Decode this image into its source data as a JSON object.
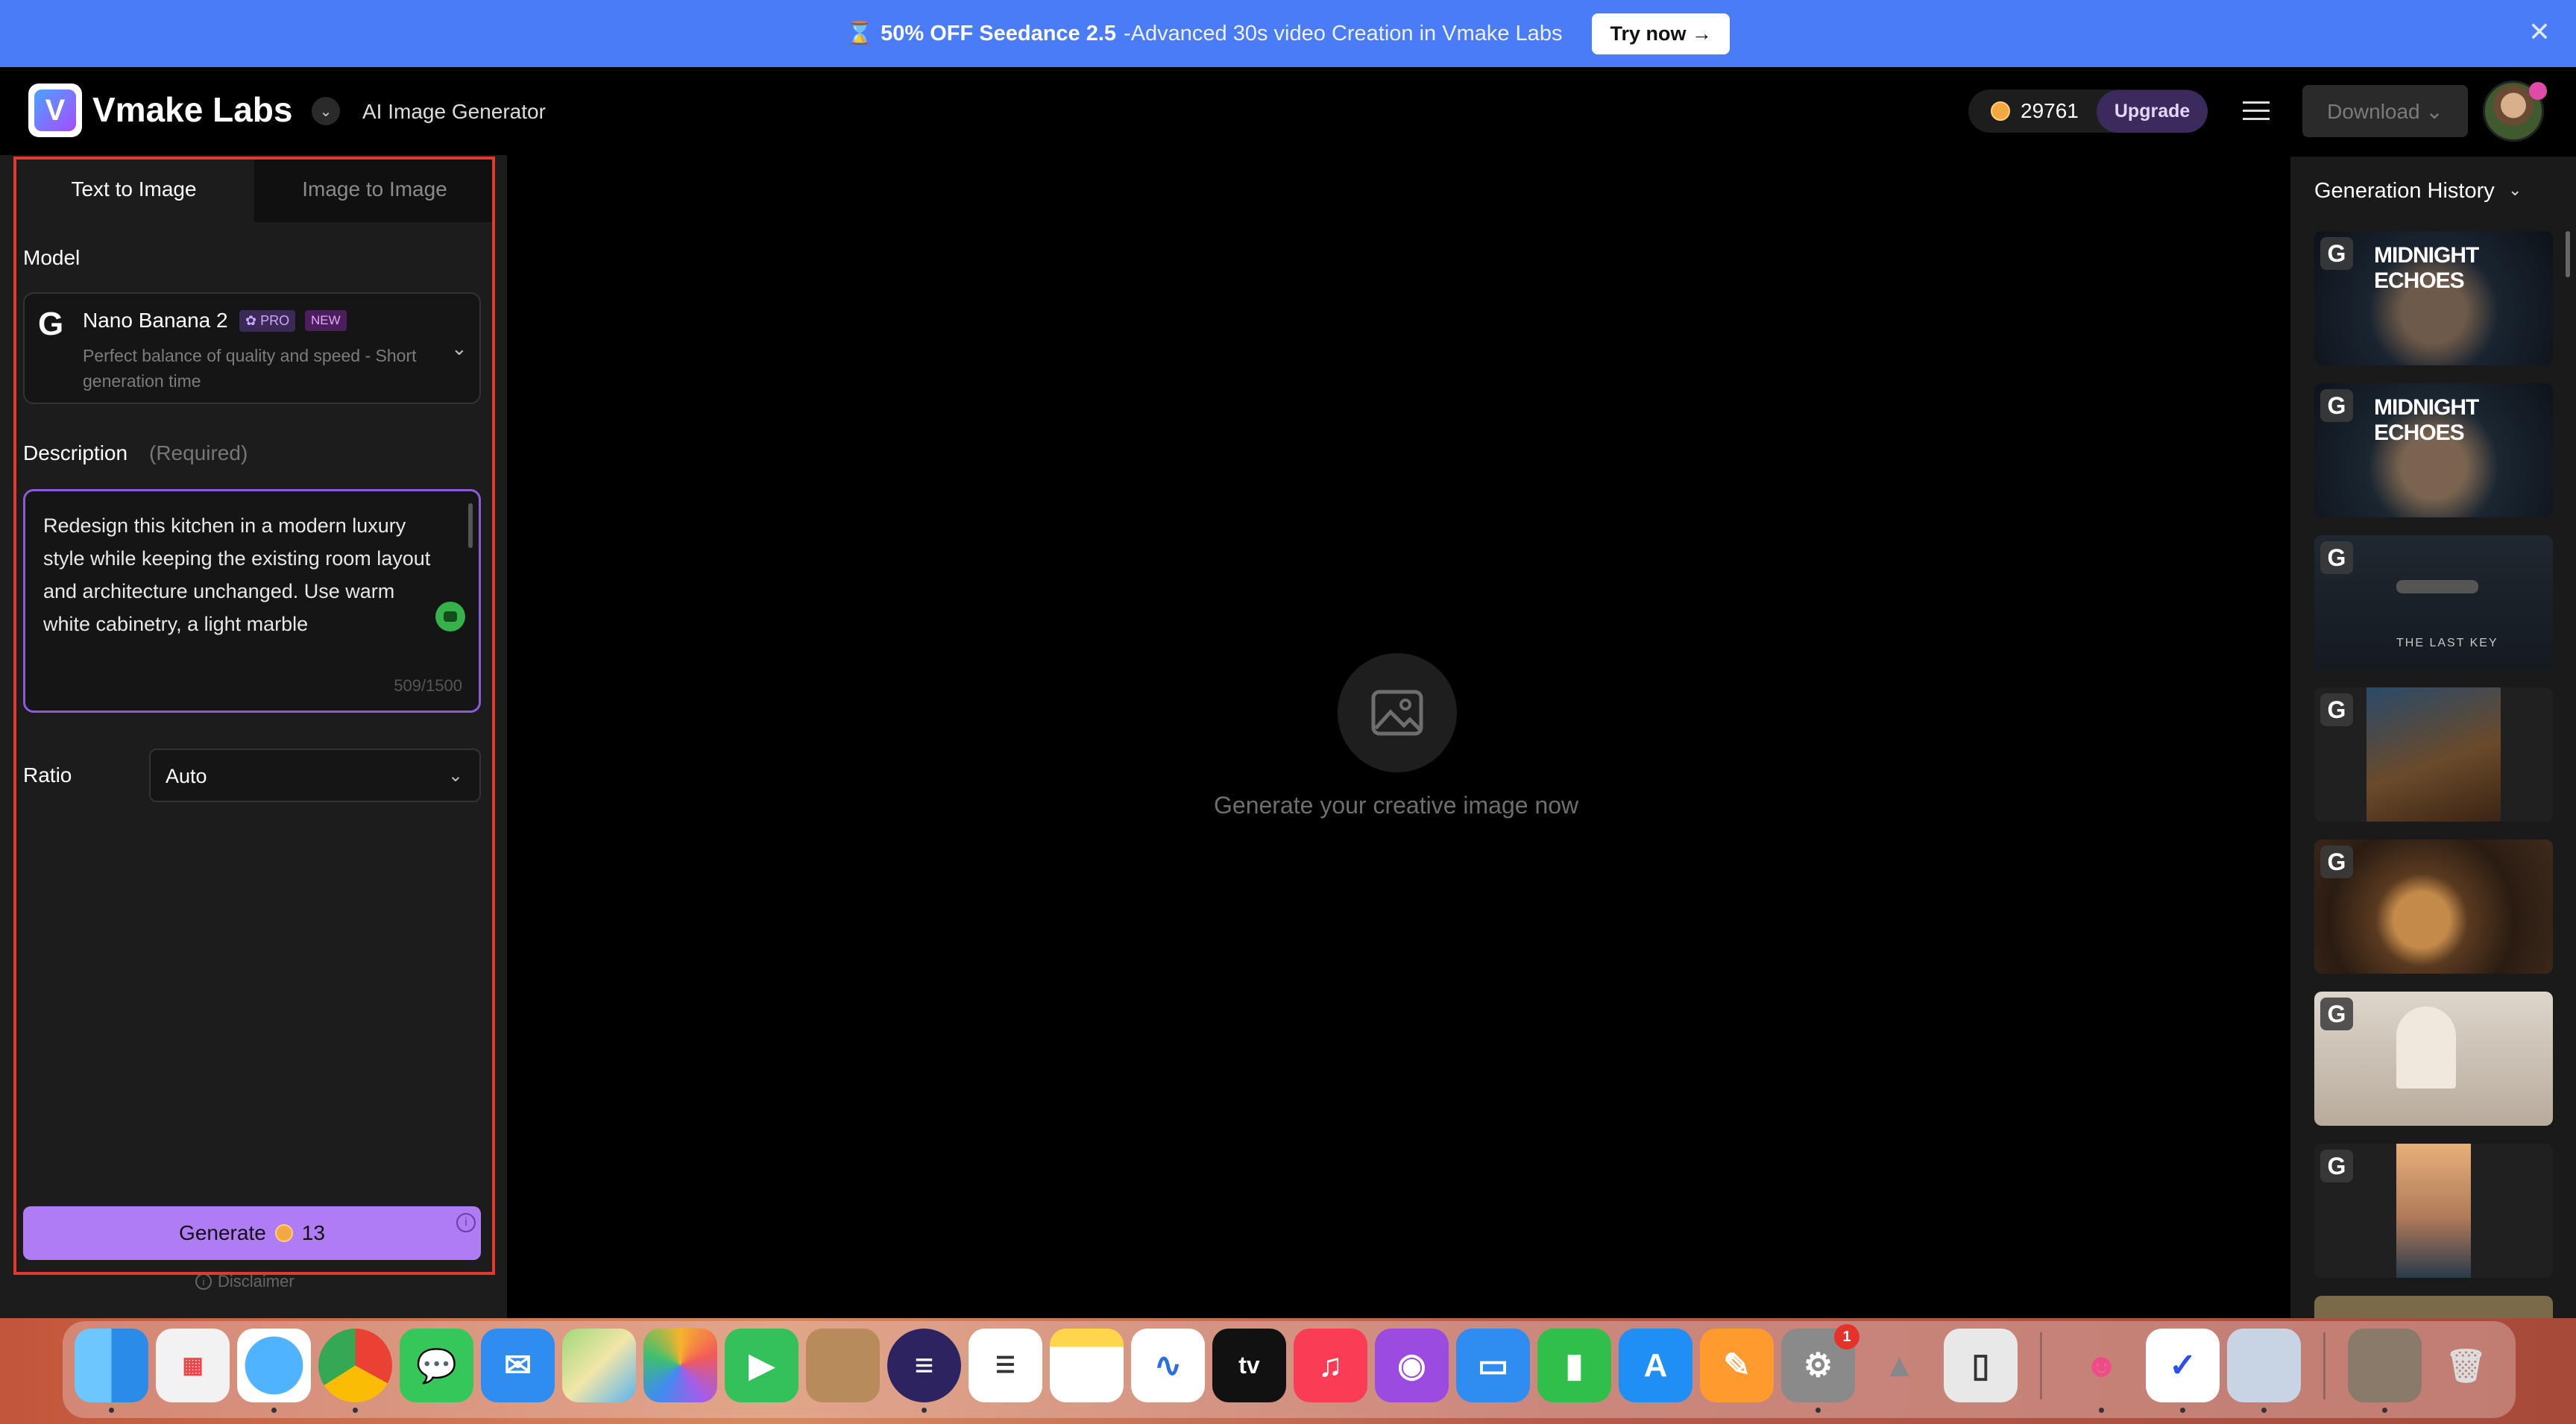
{
  "banner": {
    "emoji": "⌛",
    "promo_bold": "50% OFF Seedance 2.5",
    "promo_rest": "-Advanced 30s video Creation in Vmake Labs",
    "cta": "Try now →",
    "close": "✕"
  },
  "header": {
    "logo_letter": "V",
    "brand": "Vmake Labs",
    "subtitle": "AI Image Generator",
    "credits": "29761",
    "upgrade": "Upgrade",
    "download": "Download ⌄"
  },
  "left_panel": {
    "tabs": [
      "Text to Image",
      "Image to Image"
    ],
    "model_label": "Model",
    "model": {
      "logo": "G",
      "name": "Nano Banana 2",
      "badge_pro": "✿ PRO",
      "badge_new": "NEW",
      "description": "Perfect balance of quality and speed - Short generation time"
    },
    "description_label": "Description",
    "description_required": "(Required)",
    "description_text": "Redesign this kitchen in a modern luxury style while keeping the existing room layout and architecture unchanged. Use warm white cabinetry, a light marble",
    "char_count": "509/1500",
    "ratio_label": "Ratio",
    "ratio_value": "Auto",
    "generate_label": "Generate",
    "generate_cost": "13",
    "disclaimer": "Disclaimer"
  },
  "center": {
    "empty_text": "Generate your creative image now"
  },
  "right_panel": {
    "title": "Generation History",
    "thumb_logo": "G",
    "thumbs": [
      {
        "title": "MIDNIGHT ECHOES"
      },
      {
        "title": "MIDNIGHT ECHOES"
      },
      {
        "title": "",
        "subtitle": "THE LAST KEY"
      },
      {
        "title": ""
      },
      {
        "title": ""
      },
      {
        "title": ""
      },
      {
        "title": ""
      }
    ]
  },
  "dock": {
    "notification_count": "1",
    "apps": [
      "finder-icon",
      "launchpad-icon",
      "safari-icon",
      "chrome-icon",
      "messages-icon",
      "mail-icon",
      "maps-icon",
      "photos-icon",
      "facetime-icon",
      "contacts-icon",
      "eclipse-icon",
      "reminders-icon",
      "notes-icon",
      "freeform-icon",
      "apple-tv-icon",
      "music-icon",
      "podcasts-icon",
      "keynote-icon",
      "numbers-icon",
      "app-store-icon",
      "pages-icon",
      "system-settings-icon",
      "rocket-icon",
      "iphone-mirroring-icon",
      "robot-app-icon",
      "vmake-icon",
      "preview-icon",
      "finder-window-icon",
      "trash-icon"
    ],
    "appletv_label": "tv"
  },
  "colors": {
    "banner": "#4a7cf7",
    "accent": "#b07cf5",
    "selection_outline": "#e23a2e"
  }
}
